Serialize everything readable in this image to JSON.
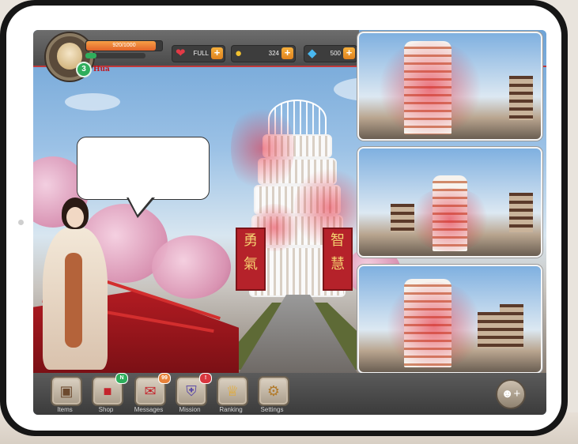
{
  "hud": {
    "xp_text": "920/1000",
    "xp_fraction": 0.92,
    "stamina_fraction": 0.18,
    "level": "3",
    "player_name": "Hua",
    "resources": [
      {
        "name": "lives",
        "icon": "heart-gem-icon",
        "value": "FULL",
        "plus": "+"
      },
      {
        "name": "coins",
        "icon": "coin-icon",
        "value": "324",
        "plus": "+"
      },
      {
        "name": "gems",
        "icon": "diamond-icon",
        "value": "500",
        "plus": "+"
      }
    ]
  },
  "scene": {
    "banner_left": [
      "勇",
      "氣"
    ],
    "banner_right": [
      "智",
      "慧"
    ],
    "speech_text": ""
  },
  "nav": {
    "items": [
      {
        "label": "Items",
        "icon": "chest-icon",
        "badge": ""
      },
      {
        "label": "Shop",
        "icon": "shop-icon",
        "badge": "N"
      },
      {
        "label": "Messages",
        "icon": "letter-icon",
        "badge": "99"
      },
      {
        "label": "Mission",
        "icon": "shield-icon",
        "badge": "!"
      },
      {
        "label": "Ranking",
        "icon": "trophy-icon",
        "badge": ""
      },
      {
        "label": "Settings",
        "icon": "gear-icon",
        "badge": ""
      }
    ],
    "friend_icon": "add-friend-icon"
  },
  "colors": {
    "accent_orange": "#e2632a",
    "badge_green": "#2fae5c",
    "badge_orange": "#e8823a",
    "badge_red": "#d9363e",
    "banner_red": "#b5222a"
  }
}
